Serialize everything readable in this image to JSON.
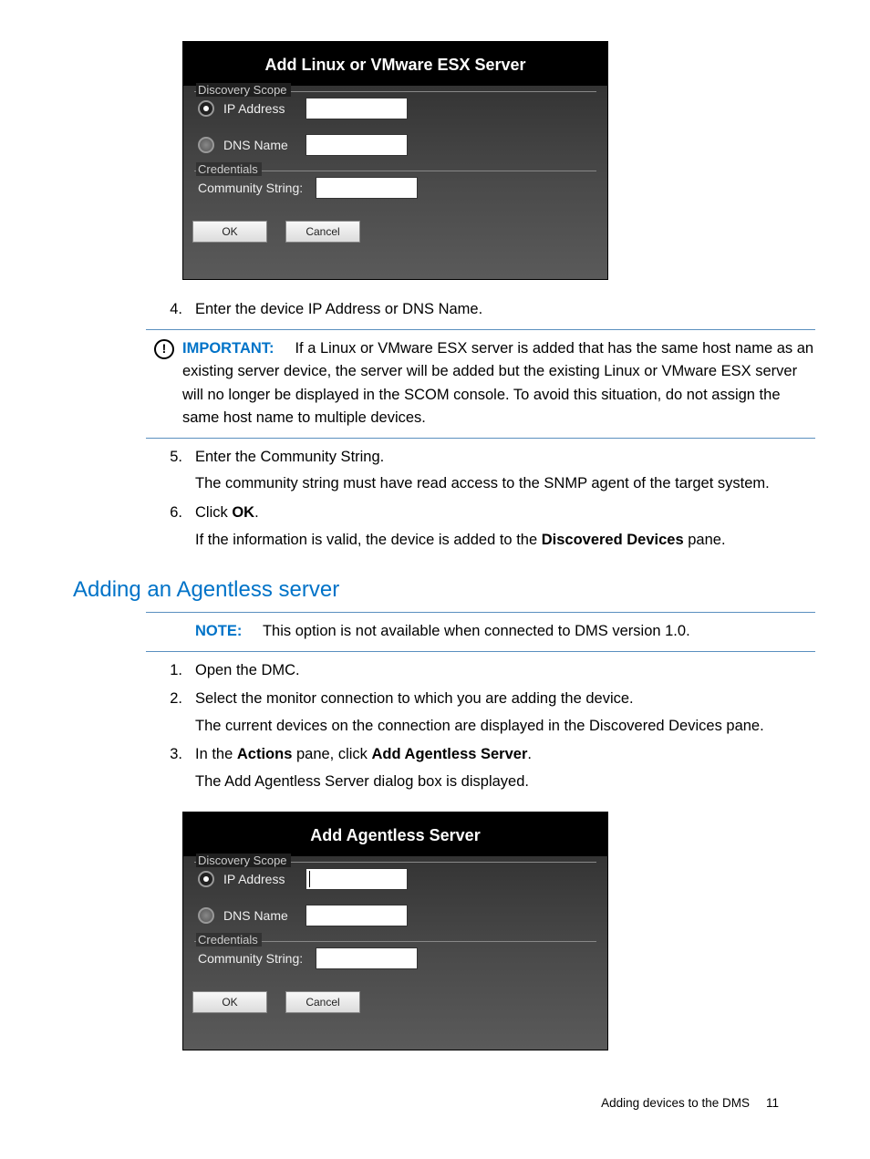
{
  "dialog1": {
    "title": "Add Linux or VMware ESX Server",
    "discovery_scope_legend": "Discovery Scope",
    "ip_address_label": "IP Address",
    "dns_name_label": "DNS Name",
    "credentials_legend": "Credentials",
    "community_string_label": "Community String:",
    "ok_label": "OK",
    "cancel_label": "Cancel"
  },
  "step4_num": "4.",
  "step4_text": "Enter the device IP Address or DNS Name.",
  "important_label": "IMPORTANT:",
  "important_text": "If a Linux or VMware ESX server is added that has the same host name as an existing server device, the server will be added but the existing Linux or VMware ESX server will no longer be displayed in the SCOM console. To avoid this situation, do not assign the same host name to multiple devices.",
  "step5_num": "5.",
  "step5_text": "Enter the Community String.",
  "step5_sub": "The community string must have read access to the SNMP agent of the target system.",
  "step6_num": "6.",
  "step6_a": "Click ",
  "step6_b": "OK",
  "step6_c": ".",
  "step6_sub_a": "If the information is valid, the device is added to the ",
  "step6_sub_b": "Discovered Devices",
  "step6_sub_c": " pane.",
  "section_heading": "Adding an Agentless server",
  "note_label": "NOTE:",
  "note_text": "This option is not available when connected to DMS version 1.0.",
  "b_step1_num": "1.",
  "b_step1_text": "Open the DMC.",
  "b_step2_num": "2.",
  "b_step2_text": "Select the monitor connection to which you are adding the device.",
  "b_step2_sub": "The current devices on the connection are displayed in the Discovered Devices pane.",
  "b_step3_num": "3.",
  "b_step3_a": "In the ",
  "b_step3_b": "Actions",
  "b_step3_c": " pane, click ",
  "b_step3_d": "Add Agentless Server",
  "b_step3_e": ".",
  "b_step3_sub": "The Add Agentless Server dialog box is displayed.",
  "dialog2": {
    "title": "Add Agentless Server",
    "discovery_scope_legend": "Discovery Scope",
    "ip_address_label": "IP Address",
    "dns_name_label": "DNS Name",
    "credentials_legend": "Credentials",
    "community_string_label": "Community String:",
    "ok_label": "OK",
    "cancel_label": "Cancel"
  },
  "footer_text": "Adding devices to the DMS",
  "footer_page": "11"
}
